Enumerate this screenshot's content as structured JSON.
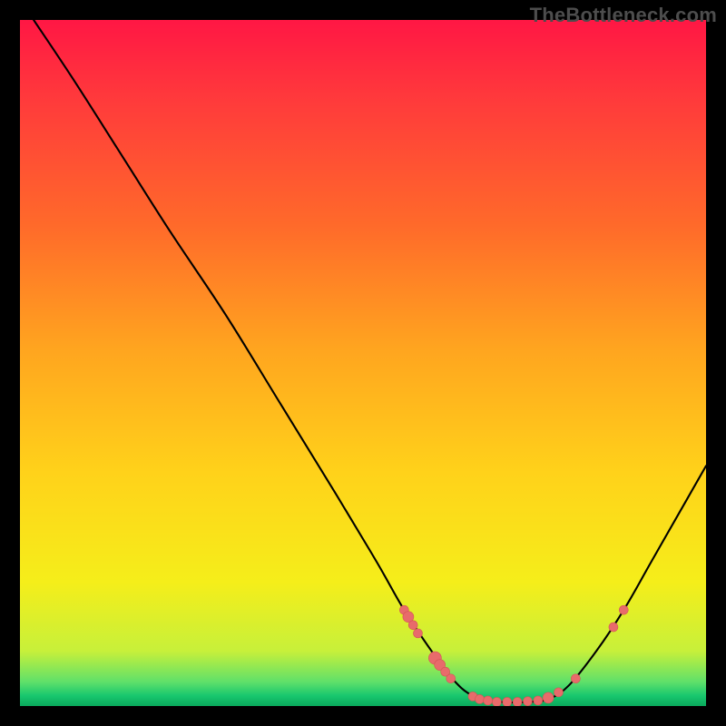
{
  "attribution": "TheBottleneck.com",
  "colors": {
    "page_bg": "#000000",
    "curve": "#000000",
    "marker_fill": "#e86b6b",
    "marker_stroke": "#d45454",
    "attribution": "#4d4d4d"
  },
  "gradient_stops": [
    {
      "offset": 0.0,
      "color": "#ff1744"
    },
    {
      "offset": 0.12,
      "color": "#ff3b3b"
    },
    {
      "offset": 0.3,
      "color": "#ff6a2a"
    },
    {
      "offset": 0.48,
      "color": "#ffa51f"
    },
    {
      "offset": 0.66,
      "color": "#ffd21a"
    },
    {
      "offset": 0.82,
      "color": "#f5ee1a"
    },
    {
      "offset": 0.92,
      "color": "#c7f03a"
    },
    {
      "offset": 0.965,
      "color": "#5fe06a"
    },
    {
      "offset": 0.985,
      "color": "#18c76e"
    },
    {
      "offset": 1.0,
      "color": "#0aa85c"
    }
  ],
  "chart_data": {
    "type": "line",
    "title": "",
    "xlabel": "",
    "ylabel": "",
    "xlim": [
      0,
      100
    ],
    "ylim": [
      0,
      100
    ],
    "series": [
      {
        "name": "bottleneck-curve",
        "points": [
          {
            "x": 2,
            "y": 100
          },
          {
            "x": 8,
            "y": 91
          },
          {
            "x": 15,
            "y": 80
          },
          {
            "x": 22,
            "y": 69
          },
          {
            "x": 30,
            "y": 57
          },
          {
            "x": 38,
            "y": 44
          },
          {
            "x": 46,
            "y": 31
          },
          {
            "x": 52,
            "y": 21
          },
          {
            "x": 56,
            "y": 14
          },
          {
            "x": 60,
            "y": 8
          },
          {
            "x": 63,
            "y": 4
          },
          {
            "x": 66,
            "y": 1.5
          },
          {
            "x": 70,
            "y": 0.6
          },
          {
            "x": 74,
            "y": 0.6
          },
          {
            "x": 77,
            "y": 1.0
          },
          {
            "x": 80,
            "y": 3
          },
          {
            "x": 84,
            "y": 8
          },
          {
            "x": 88,
            "y": 14
          },
          {
            "x": 92,
            "y": 21
          },
          {
            "x": 96,
            "y": 28
          },
          {
            "x": 100,
            "y": 35
          }
        ]
      }
    ],
    "markers": [
      {
        "x": 56.0,
        "y": 14.0,
        "r": 5
      },
      {
        "x": 56.6,
        "y": 13.0,
        "r": 6
      },
      {
        "x": 57.3,
        "y": 11.8,
        "r": 5
      },
      {
        "x": 58.0,
        "y": 10.6,
        "r": 5
      },
      {
        "x": 60.5,
        "y": 7.0,
        "r": 7
      },
      {
        "x": 61.2,
        "y": 6.0,
        "r": 6
      },
      {
        "x": 62.0,
        "y": 5.0,
        "r": 5
      },
      {
        "x": 62.8,
        "y": 4.0,
        "r": 5
      },
      {
        "x": 66.0,
        "y": 1.4,
        "r": 5
      },
      {
        "x": 67.0,
        "y": 1.0,
        "r": 5
      },
      {
        "x": 68.2,
        "y": 0.8,
        "r": 5
      },
      {
        "x": 69.5,
        "y": 0.6,
        "r": 5
      },
      {
        "x": 71.0,
        "y": 0.6,
        "r": 5
      },
      {
        "x": 72.5,
        "y": 0.6,
        "r": 5
      },
      {
        "x": 74.0,
        "y": 0.7,
        "r": 5
      },
      {
        "x": 75.5,
        "y": 0.8,
        "r": 5
      },
      {
        "x": 77.0,
        "y": 1.2,
        "r": 6
      },
      {
        "x": 78.5,
        "y": 2.0,
        "r": 5
      },
      {
        "x": 81.0,
        "y": 4.0,
        "r": 5
      },
      {
        "x": 86.5,
        "y": 11.5,
        "r": 5
      },
      {
        "x": 88.0,
        "y": 14.0,
        "r": 5
      }
    ]
  }
}
